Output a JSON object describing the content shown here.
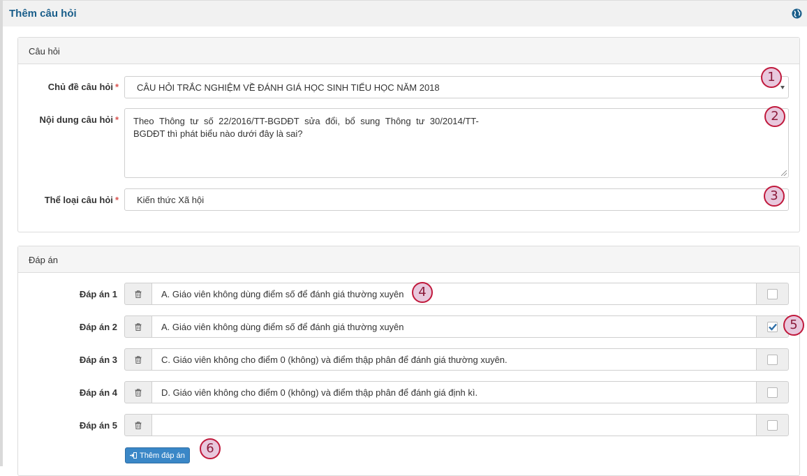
{
  "page": {
    "title": "Thêm câu hỏi"
  },
  "question_panel": {
    "title": "Câu hỏi",
    "topic": {
      "label": "Chủ đề câu hỏi",
      "value": "CÂU HỎI TRẮC NGHIỆM VỀ ĐÁNH GIÁ HỌC SINH TIỂU HỌC NĂM 2018"
    },
    "content": {
      "label": "Nội dung câu hỏi",
      "line1_words": [
        "Theo",
        "Thông",
        "tư",
        "số",
        "22/2016/TT-BGDĐT",
        "sửa",
        "đổi,",
        "bổ",
        "sung",
        "Thông",
        "tư",
        "30/2014/TT-"
      ],
      "line2": "BGDĐT thì phát biểu nào dưới đây là sai?"
    },
    "category": {
      "label": "Thể loại câu hỏi",
      "value": "Kiến thức Xã hội"
    },
    "required_mark": "*"
  },
  "answers_panel": {
    "title": "Đáp án",
    "answers": [
      {
        "label": "Đáp án 1",
        "value": "A. Giáo viên không dùng điểm số để đánh giá thường xuyên",
        "correct": false
      },
      {
        "label": "Đáp án 2",
        "value": "A. Giáo viên không dùng điểm số để đánh giá thường xuyên",
        "correct": true
      },
      {
        "label": "Đáp án 3",
        "value": "C. Giáo viên không cho điểm 0 (không) và điểm thập phân để đánh giá thường xuyên.",
        "correct": false
      },
      {
        "label": "Đáp án 4",
        "value": "D. Giáo viên không cho điểm 0 (không) và điểm thập phân để đánh giá định kì.",
        "correct": false
      },
      {
        "label": "Đáp án 5",
        "value": "",
        "correct": false
      }
    ],
    "add_button": "Thêm đáp án"
  },
  "markers": [
    "1",
    "2",
    "3",
    "4",
    "5",
    "6"
  ],
  "colors": {
    "title": "#1a5e8a",
    "button": "#3a87c7",
    "required": "#d9534f",
    "marker_border": "#c0193c",
    "marker_fill": "#e8c8dd"
  }
}
